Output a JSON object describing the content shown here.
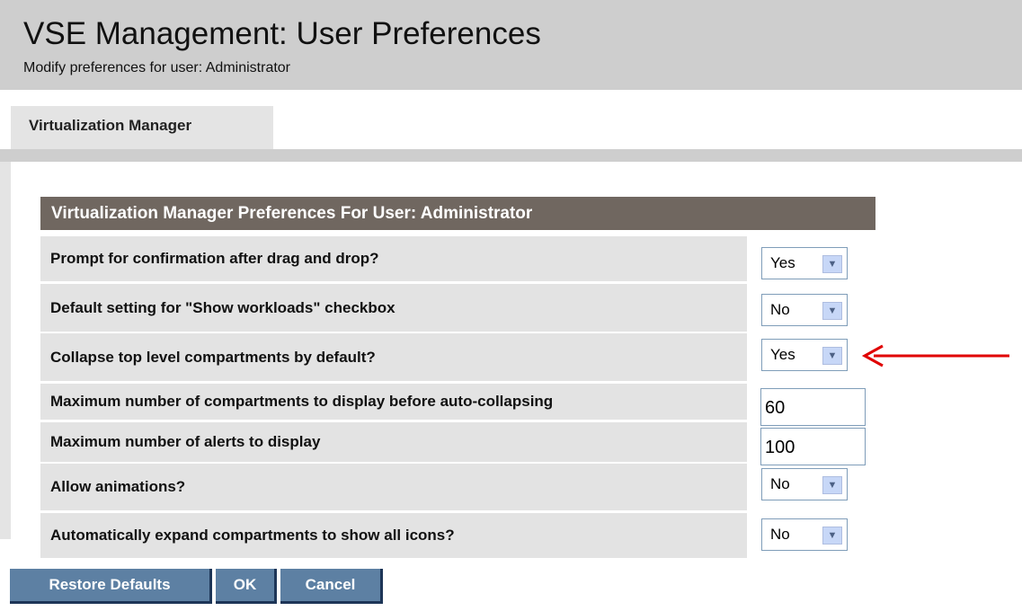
{
  "header": {
    "title": "VSE Management: User Preferences",
    "subtitle": "Modify preferences for user: Administrator"
  },
  "tabs": [
    {
      "label": "Virtualization Manager",
      "active": true
    }
  ],
  "panel": {
    "heading": "Virtualization Manager Preferences For User: Administrator",
    "rows": [
      {
        "label": "Prompt for confirmation after drag and drop?",
        "type": "select",
        "value": "Yes"
      },
      {
        "label": "Default setting for \"Show workloads\" checkbox",
        "type": "select",
        "value": "No"
      },
      {
        "label": "Collapse top level compartments by default?",
        "type": "select",
        "value": "Yes"
      },
      {
        "label": "Maximum number of compartments to display before auto-collapsing",
        "type": "text",
        "value": "60"
      },
      {
        "label": "Maximum number of alerts to display",
        "type": "text",
        "value": "100"
      },
      {
        "label": "Allow animations?",
        "type": "select",
        "value": "No"
      },
      {
        "label": "Automatically expand compartments to show all icons?",
        "type": "select",
        "value": "No"
      }
    ]
  },
  "buttons": {
    "restore_defaults": "Restore Defaults",
    "ok": "OK",
    "cancel": "Cancel"
  },
  "icons": {
    "dropdown": "chevron-down-icon",
    "annotation": "arrow-left-icon"
  },
  "colors": {
    "header_bg": "#cecece",
    "panel_heading_bg": "#706760",
    "row_bg": "#e3e3e3",
    "button_bg": "#5d80a3",
    "annotation_arrow": "#e00000"
  }
}
